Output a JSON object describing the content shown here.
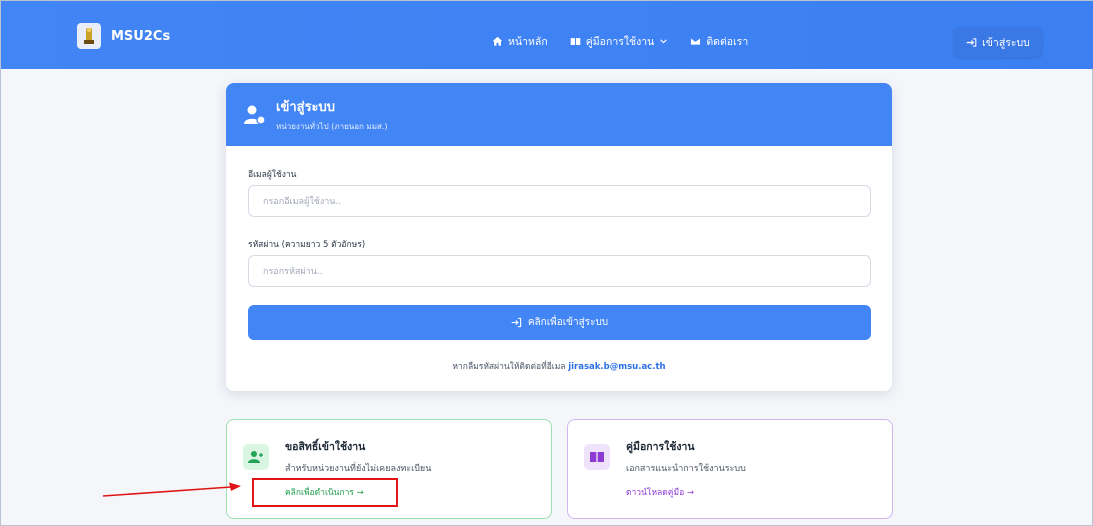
{
  "navbar": {
    "brand": "MSU2Cs",
    "links": [
      {
        "label": "หน้าหลัก",
        "icon": "home-icon"
      },
      {
        "label": "คู่มือการใช้งาน",
        "icon": "book-icon",
        "dropdown": true
      },
      {
        "label": "ติดต่อเรา",
        "icon": "mail-icon"
      }
    ],
    "login_label": "เข้าสู่ระบบ"
  },
  "login_card": {
    "title": "เข้าสู่ระบบ",
    "subtitle": "หน่วยงานทั่วไป (ภายนอก มมส.)",
    "email_label": "อีเมลผู้ใช้งาน",
    "email_placeholder": "กรอกอีเมลผู้ใช้งาน..",
    "password_label": "รหัสผ่าน (ความยาว 5 ตัวอักษร)",
    "password_placeholder": "กรอกรหัสผ่าน..",
    "submit_label": "คลิกเพื่อเข้าสู่ระบบ",
    "forgot_text": "หากลืมรหัสผ่านให้ติดต่อที่อีเมล",
    "forgot_email": "jirasak.b@msu.ac.th"
  },
  "request_card": {
    "title": "ขอสิทธิ์เข้าใช้งาน",
    "desc": "สำหรับหน่วยงานที่ยังไม่เคยลงทะเบียน",
    "link": "คลิกเพื่อดำเนินการ →"
  },
  "manual_card": {
    "title": "คู่มือการใช้งาน",
    "desc": "เอกสารแนะนำการใช้งานระบบ",
    "link": "ดาวน์โหลดคู่มือ →"
  },
  "colors": {
    "primary": "#4285f4",
    "green": "#1f9d4c",
    "purple": "#8e3bd6",
    "annotation": "#e01414"
  }
}
